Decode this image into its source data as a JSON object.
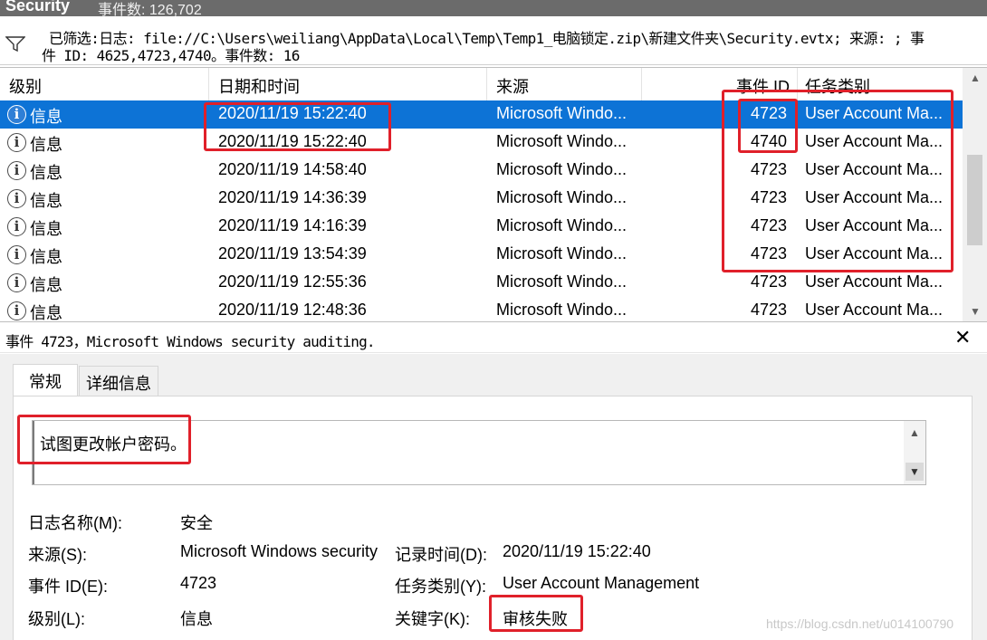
{
  "window": {
    "log_name": "Security",
    "event_count": "事件数: 126,702"
  },
  "filter": {
    "line1": "已筛选:日志: file://C:\\Users\\weiliang\\AppData\\Local\\Temp\\Temp1_电脑锁定.zip\\新建文件夹\\Security.evtx; 来源: ; 事",
    "line2": "件 ID: 4625,4723,4740。事件数: 16"
  },
  "table": {
    "columns": {
      "level": "级别",
      "datetime": "日期和时间",
      "source": "来源",
      "event_id": "事件 ID",
      "task_category": "任务类别"
    },
    "rows": [
      {
        "level": "信息",
        "datetime": "2020/11/19 15:22:40",
        "source": "Microsoft Windo...",
        "event_id": "4723",
        "task": "User Account Ma..."
      },
      {
        "level": "信息",
        "datetime": "2020/11/19 15:22:40",
        "source": "Microsoft Windo...",
        "event_id": "4740",
        "task": "User Account Ma..."
      },
      {
        "level": "信息",
        "datetime": "2020/11/19 14:58:40",
        "source": "Microsoft Windo...",
        "event_id": "4723",
        "task": "User Account Ma..."
      },
      {
        "level": "信息",
        "datetime": "2020/11/19 14:36:39",
        "source": "Microsoft Windo...",
        "event_id": "4723",
        "task": "User Account Ma..."
      },
      {
        "level": "信息",
        "datetime": "2020/11/19 14:16:39",
        "source": "Microsoft Windo...",
        "event_id": "4723",
        "task": "User Account Ma..."
      },
      {
        "level": "信息",
        "datetime": "2020/11/19 13:54:39",
        "source": "Microsoft Windo...",
        "event_id": "4723",
        "task": "User Account Ma..."
      },
      {
        "level": "信息",
        "datetime": "2020/11/19 12:55:36",
        "source": "Microsoft Windo...",
        "event_id": "4723",
        "task": "User Account Ma..."
      },
      {
        "level": "信息",
        "datetime": "2020/11/19 12:48:36",
        "source": "Microsoft Windo...",
        "event_id": "4723",
        "task": "User Account Ma..."
      }
    ]
  },
  "event_detail": {
    "title": "事件 4723，Microsoft Windows security auditing.",
    "close_symbol": "✕",
    "tabs": {
      "general": "常规",
      "details": "详细信息"
    },
    "description": "试图更改帐户密码。",
    "fields": {
      "log_name_label": "日志名称(M):",
      "log_name_value": "安全",
      "source_label": "来源(S):",
      "source_value": "Microsoft Windows security",
      "logged_label": "记录时间(D):",
      "logged_value": "2020/11/19 15:22:40",
      "event_id_label": "事件 ID(E):",
      "event_id_value": "4723",
      "task_label": "任务类别(Y):",
      "task_value": "User Account Management",
      "level_label": "级别(L):",
      "level_value": "信息",
      "keywords_label": "关键字(K):",
      "keywords_value": "审核失败"
    }
  },
  "watermark": "https://blog.csdn.net/u014100790",
  "colors": {
    "selection": "#0d73d6",
    "highlight_box": "#e0202a",
    "title_bar": "#6b6b6b"
  }
}
